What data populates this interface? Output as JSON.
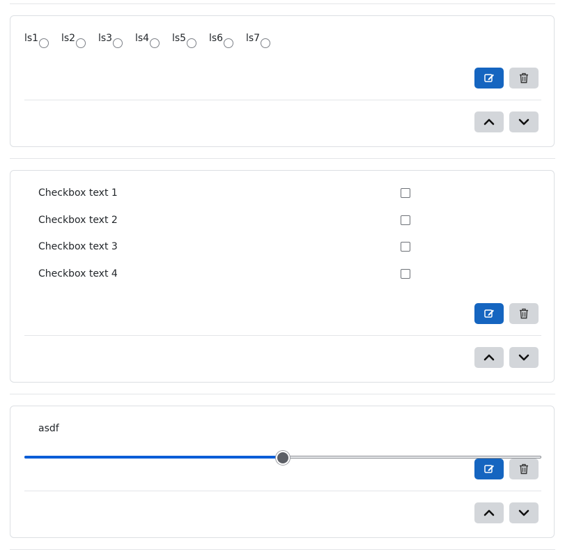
{
  "radio_card": {
    "options": [
      "ls1",
      "ls2",
      "ls3",
      "ls4",
      "ls5",
      "ls6",
      "ls7"
    ]
  },
  "checkbox_card": {
    "items": [
      {
        "label": "Checkbox text 1",
        "checked": false
      },
      {
        "label": "Checkbox text 2",
        "checked": false
      },
      {
        "label": "Checkbox text 3",
        "checked": false
      },
      {
        "label": "Checkbox text 4",
        "checked": false
      }
    ]
  },
  "slider_card": {
    "label": "asdf",
    "value_fraction": 0.5
  },
  "icons": {
    "edit": "edit-icon",
    "delete": "trash-icon",
    "up": "chevron-up-icon",
    "down": "chevron-down-icon"
  },
  "colors": {
    "primary": "#1565c0",
    "secondary": "#d3d6da",
    "slider_fill": "#0b5ed7"
  }
}
